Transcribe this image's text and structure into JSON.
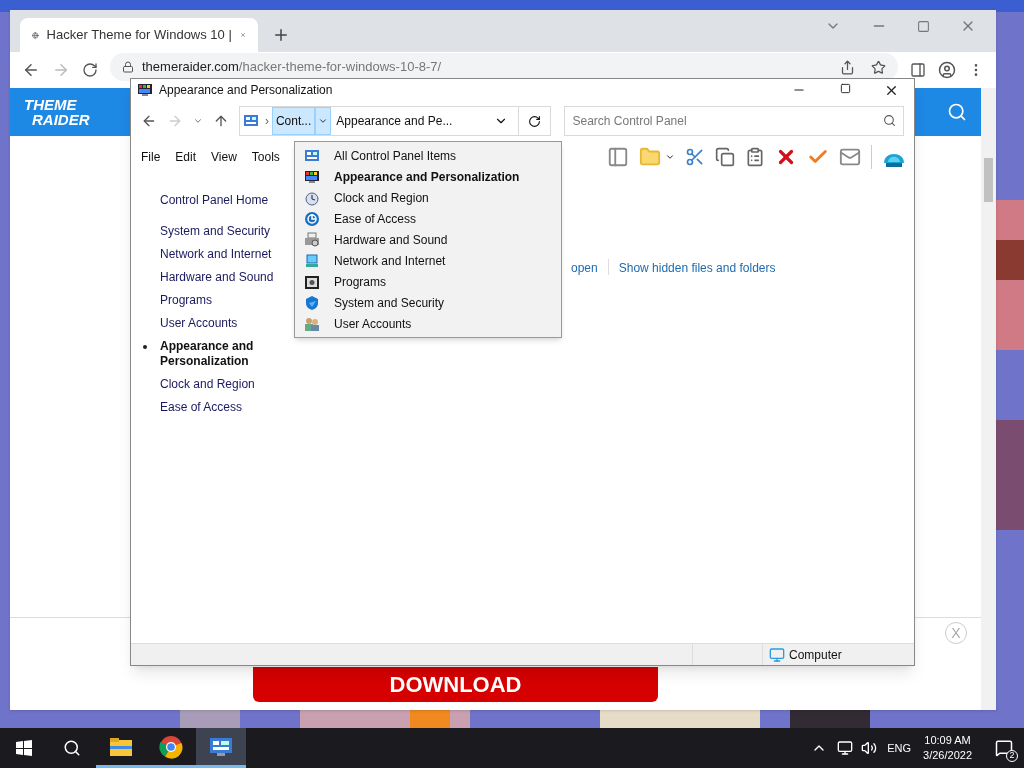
{
  "browser": {
    "tab_title": "Hacker Theme for Windows 10 |",
    "url_host": "themeraider.com",
    "url_path": "/hacker-theme-for-windows-10-8-7/",
    "logo": [
      "THEME",
      "RAIDER"
    ]
  },
  "ad": {
    "close": "X",
    "button": "DOWNLOAD"
  },
  "explorer": {
    "title": "Appearance and Personalization",
    "dropdown_open": true,
    "breadcrumb_separator": "›",
    "breadcrumb": [
      "Cont...",
      "Appearance and Pe..."
    ],
    "search_placeholder": "Search Control Panel",
    "menu": [
      "File",
      "Edit",
      "View",
      "Tools"
    ],
    "nav_home": "Control Panel Home",
    "nav": [
      {
        "label": "System and Security",
        "selected": false
      },
      {
        "label": "Network and Internet",
        "selected": false
      },
      {
        "label": "Hardware and Sound",
        "selected": false
      },
      {
        "label": "Programs",
        "selected": false
      },
      {
        "label": "User Accounts",
        "selected": false
      },
      {
        "label": "Appearance and Personalization",
        "selected": true
      },
      {
        "label": "Clock and Region",
        "selected": false
      },
      {
        "label": "Ease of Access",
        "selected": false
      }
    ],
    "links": [
      "open",
      "Show hidden files and folders"
    ],
    "status": "Computer",
    "dropdown": [
      {
        "label": "All Control Panel Items",
        "kind": "all",
        "selected": false
      },
      {
        "label": "Appearance and Personalization",
        "kind": "appearance",
        "selected": true
      },
      {
        "label": "Clock and Region",
        "kind": "clock",
        "selected": false
      },
      {
        "label": "Ease of Access",
        "kind": "ease",
        "selected": false
      },
      {
        "label": "Hardware and Sound",
        "kind": "hardware",
        "selected": false
      },
      {
        "label": "Network and Internet",
        "kind": "network",
        "selected": false
      },
      {
        "label": "Programs",
        "kind": "programs",
        "selected": false
      },
      {
        "label": "System and Security",
        "kind": "system",
        "selected": false
      },
      {
        "label": "User Accounts",
        "kind": "users",
        "selected": false
      }
    ]
  },
  "taskbar": {
    "apps": [
      {
        "kind": "files",
        "active": false
      },
      {
        "kind": "browser",
        "active": false
      },
      {
        "kind": "control-panel",
        "active": true
      }
    ],
    "language": "ENG",
    "time": "10:09 AM",
    "date": "3/26/2022",
    "notifications": "2"
  }
}
